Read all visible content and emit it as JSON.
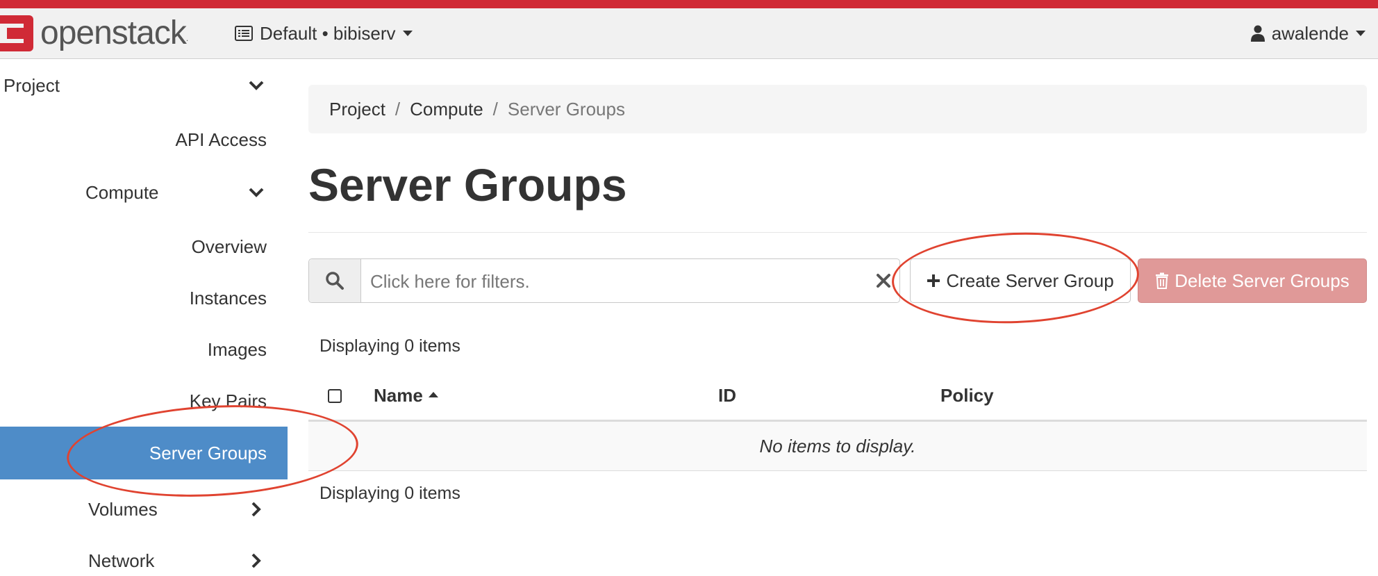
{
  "brand": {
    "logo_text": "openstack",
    "logo_dot": "."
  },
  "header": {
    "project_selector": "Default • bibiserv",
    "user_name": "awalende"
  },
  "sidebar": {
    "project_label": "Project",
    "api_access": "API Access",
    "compute_label": "Compute",
    "compute_items": [
      "Overview",
      "Instances",
      "Images",
      "Key Pairs"
    ],
    "active_item": "Server Groups",
    "volumes_label": "Volumes",
    "network_label": "Network"
  },
  "breadcrumb": {
    "items": [
      "Project",
      "Compute"
    ],
    "current": "Server Groups",
    "separator": "/"
  },
  "page": {
    "title": "Server Groups"
  },
  "toolbar": {
    "filter_placeholder": "Click here for filters.",
    "create_label": "Create Server Group",
    "delete_label": "Delete Server Groups"
  },
  "table": {
    "display_count": "Displaying 0 items",
    "columns": [
      "Name",
      "ID",
      "Policy"
    ],
    "sorted_column": "Name",
    "empty_message": "No items to display."
  },
  "colors": {
    "brand_red": "#d02a36",
    "active_nav": "#4e8cc8",
    "danger_button": "#e09998",
    "annotation": "#e04330"
  }
}
